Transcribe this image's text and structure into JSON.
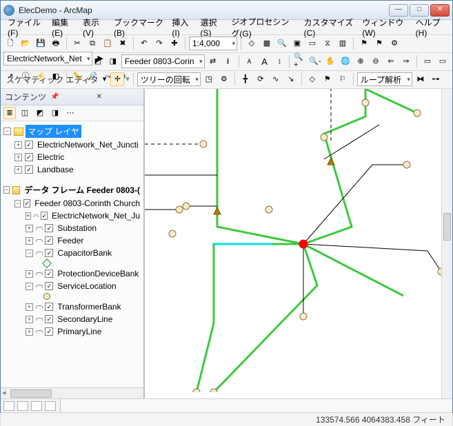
{
  "window": {
    "title": "ElecDemo - ArcMap"
  },
  "menus": [
    "ファイル(F)",
    "編集(E)",
    "表示(V)",
    "ブックマーク(B)",
    "挿入(I)",
    "選択(S)",
    "ジオプロセシング(G)",
    "カスタマイズ(C)",
    "ウィンドウ(W)",
    "ヘルプ(H)"
  ],
  "tb1": {
    "scale": "1:4,000",
    "net_combo": "ElectricNetwork_Net"
  },
  "tb2": {
    "label": "スケマティック",
    "diagram_combo": "Feeder 0803-Corin"
  },
  "tb3": {
    "label": "スケマティック エディタ",
    "tree_combo": "ツリーの回転",
    "loop_combo": "ループ解析"
  },
  "toc": {
    "title": "コンテンツ",
    "map_layers_label": "マップ レイヤ",
    "layers1": [
      {
        "label": "ElectricNetwork_Net_Juncti",
        "checked": true
      },
      {
        "label": "Electric",
        "checked": true
      },
      {
        "label": "Landbase",
        "checked": true
      }
    ],
    "frame2_label": "データ フレーム Feeder 0803-(",
    "feeder_root": "Feeder 0803-Corinth Church",
    "layers2": [
      {
        "label": "ElectricNetwork_Net_Ju",
        "checked": true
      },
      {
        "label": "Substation",
        "checked": true
      },
      {
        "label": "Feeder",
        "checked": true
      },
      {
        "label": "CapacitorBank",
        "checked": true,
        "expanded": true,
        "sym": "square"
      },
      {
        "label": "ProtectionDeviceBank",
        "checked": true
      },
      {
        "label": "ServiceLocation",
        "checked": true,
        "expanded": true,
        "sym": "circle"
      },
      {
        "label": "TransformerBank",
        "checked": true
      },
      {
        "label": "SecondaryLine",
        "checked": true
      },
      {
        "label": "PrimaryLine",
        "checked": true
      }
    ]
  },
  "status": {
    "coords": "133574.566 4064383.458 フィート"
  }
}
